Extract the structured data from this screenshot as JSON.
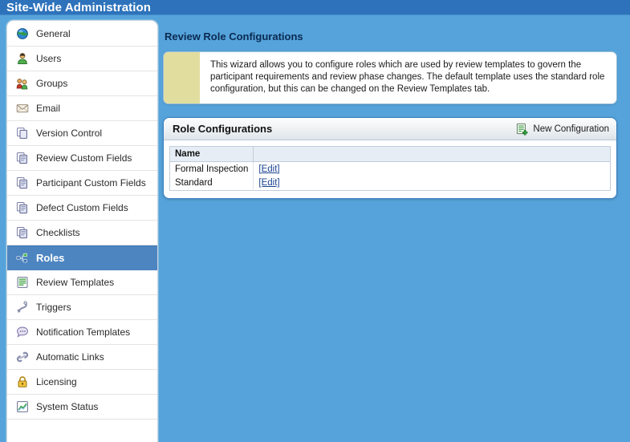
{
  "header": {
    "title": "Site-Wide Administration"
  },
  "colors": {
    "page_background": "#55a3da",
    "header_bar": "#2d72bb",
    "selected_item": "#4d85c1",
    "info_strip": "#e1dd9f",
    "panel_border": "#3c7fc0",
    "link": "#17418f"
  },
  "sidebar": {
    "items": [
      {
        "label": "General",
        "icon": "globe-icon",
        "selected": false
      },
      {
        "label": "Users",
        "icon": "user-icon",
        "selected": false
      },
      {
        "label": "Groups",
        "icon": "group-icon",
        "selected": false
      },
      {
        "label": "Email",
        "icon": "envelope-icon",
        "selected": false
      },
      {
        "label": "Version Control",
        "icon": "copy-pages-icon",
        "selected": false
      },
      {
        "label": "Review Custom Fields",
        "icon": "document-stack-icon",
        "selected": false
      },
      {
        "label": "Participant Custom Fields",
        "icon": "document-stack-icon",
        "selected": false
      },
      {
        "label": "Defect Custom Fields",
        "icon": "document-stack-icon",
        "selected": false
      },
      {
        "label": "Checklists",
        "icon": "document-stack-icon",
        "selected": false
      },
      {
        "label": "Roles",
        "icon": "roles-network-icon",
        "selected": true
      },
      {
        "label": "Review Templates",
        "icon": "lined-document-icon",
        "selected": false
      },
      {
        "label": "Triggers",
        "icon": "trigger-hook-icon",
        "selected": false
      },
      {
        "label": "Notification Templates",
        "icon": "speech-bubble-icon",
        "selected": false
      },
      {
        "label": "Automatic Links",
        "icon": "chain-link-icon",
        "selected": false
      },
      {
        "label": "Licensing",
        "icon": "padlock-icon",
        "selected": false
      },
      {
        "label": "System Status",
        "icon": "chart-icon",
        "selected": false
      }
    ]
  },
  "main": {
    "title": "Review Role Configurations",
    "info": {
      "text": "This wizard allows you to configure roles which are used by review templates to govern the participant requirements and review phase changes. The default template uses the standard role configuration, but this can be changed on the Review Templates tab."
    },
    "panel": {
      "title": "Role Configurations",
      "action": {
        "label": "New Configuration",
        "icon": "new-document-icon"
      },
      "table": {
        "columns": [
          "Name",
          ""
        ],
        "rows": [
          {
            "name": "Formal Inspection",
            "action": "[Edit]"
          },
          {
            "name": "Standard",
            "action": "[Edit]"
          }
        ]
      }
    }
  }
}
